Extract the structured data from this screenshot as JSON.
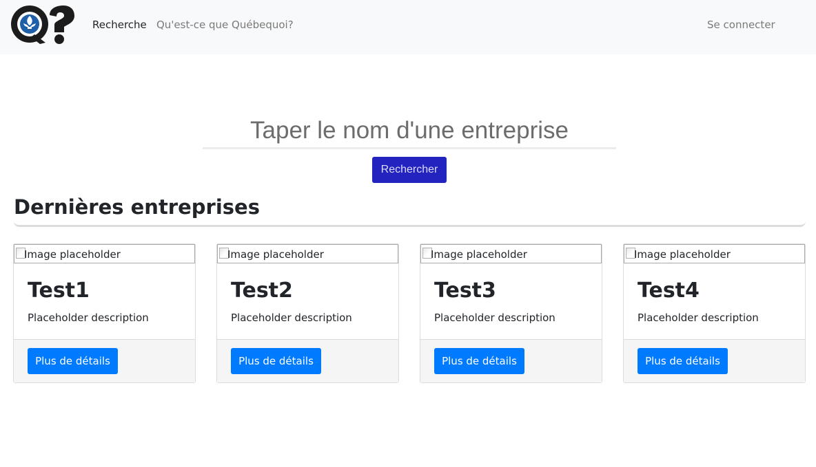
{
  "navbar": {
    "logo_text": "Q?",
    "links": [
      {
        "label": "Recherche"
      },
      {
        "label": "Qu'est-ce que Québequoi?"
      }
    ],
    "login_label": "Se connecter",
    "background": "#f8f9fa"
  },
  "search": {
    "placeholder": "Taper le nom d'une entreprise",
    "button_label": "Rechercher",
    "button_color": "#2323c0"
  },
  "section": {
    "title": "Dernières entreprises"
  },
  "cards": [
    {
      "image_alt": "Image placeholder",
      "title": "Test1",
      "description": "Placeholder description",
      "button_label": "Plus de détails"
    },
    {
      "image_alt": "Image placeholder",
      "title": "Test2",
      "description": "Placeholder description",
      "button_label": "Plus de détails"
    },
    {
      "image_alt": "Image placeholder",
      "title": "Test3",
      "description": "Placeholder description",
      "button_label": "Plus de détails"
    },
    {
      "image_alt": "Image placeholder",
      "title": "Test4",
      "description": "Placeholder description",
      "button_label": "Plus de détails"
    }
  ],
  "colors": {
    "primary": "#007bff",
    "text": "#212529",
    "muted": "#7a7a7a"
  }
}
